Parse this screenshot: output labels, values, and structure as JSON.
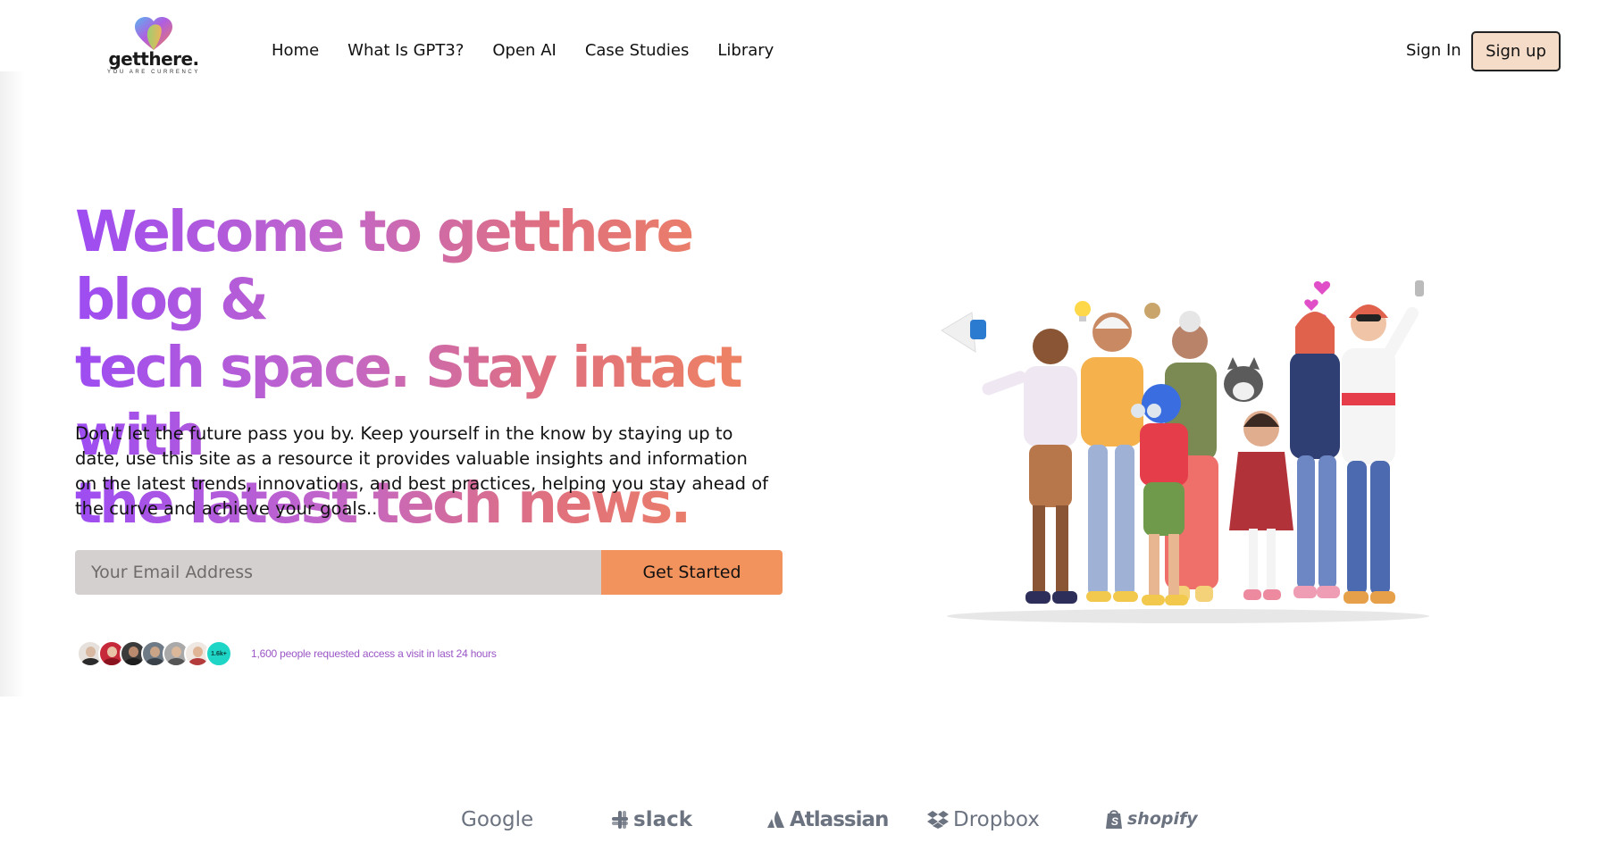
{
  "brand": {
    "name": "getthere.",
    "tagline": "YOU ARE CURRENCY",
    "logo_icon": "heart-logo-icon",
    "colors": {
      "accent": "#f2935e",
      "signup_bg": "#f5dcc9",
      "gradient_start": "#9d4cf2",
      "gradient_end": "#f2895a"
    }
  },
  "nav": {
    "links": [
      "Home",
      "What Is GPT3?",
      "Open AI",
      "Case Studies",
      "Library"
    ],
    "sign_in": "Sign In",
    "sign_up": "Sign up"
  },
  "hero": {
    "title_lines": [
      "Welcome to getthere blog &",
      "tech space. Stay intact with",
      "the latest tech news."
    ],
    "description": "Don't let the future pass you by. Keep yourself in the know by staying up to date, use this site as a resource it provides valuable insights and information on the latest trends, innovations, and best practices, helping you stay ahead of the curve and achieve your goals..",
    "email_placeholder": "Your Email Address",
    "cta": "Get Started",
    "avatar_count_badge": "1.6k+",
    "social_proof": "1,600 people requested access a visit in last 24 hours"
  },
  "partners": [
    "Google",
    "slack",
    "Atlassian",
    "Dropbox",
    "shopify"
  ]
}
